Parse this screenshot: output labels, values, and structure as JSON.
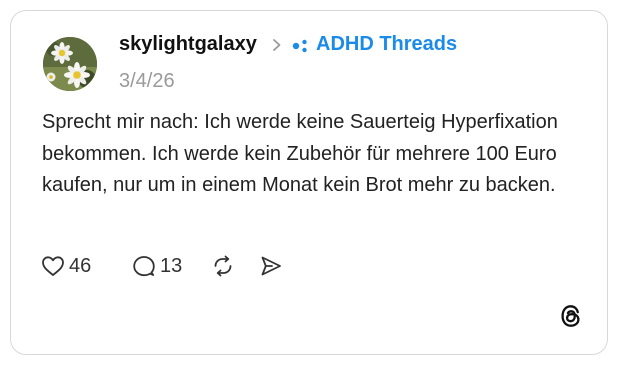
{
  "post": {
    "username": "skylightgalaxy",
    "community": "ADHD Threads",
    "date": "3/4/26",
    "text": "Sprecht mir nach: Ich werde keine Sauerteig Hyperfixation bekommen. Ich werde kein Zubehör für mehrere 100 Euro kaufen, nur um in einem Monat kein Brot mehr zu backen."
  },
  "actions": {
    "likes": "46",
    "replies": "13"
  },
  "icons": {
    "avatar": "daisy-photo-avatar",
    "separator": "chevron-right-icon",
    "community": "community-dots-icon",
    "like": "heart-icon",
    "reply": "speech-bubble-icon",
    "repost": "repost-icon",
    "share": "send-icon",
    "logo": "threads-logo-icon"
  },
  "colors": {
    "accent": "#1b8bea",
    "text": "#222222",
    "muted": "#9a9a9a",
    "border": "#d8d8d8"
  }
}
